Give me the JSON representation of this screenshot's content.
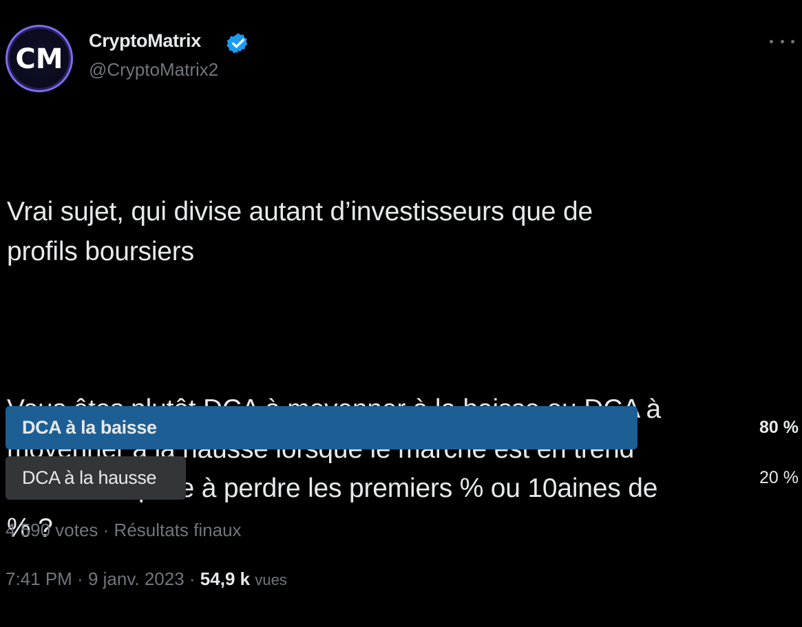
{
  "author": {
    "name": "CryptoMatrix",
    "handle": "@CryptoMatrix2",
    "avatar_text": "CM",
    "verified_color": "#1d9bf0"
  },
  "tweet": {
    "paragraph1": "Vrai sujet, qui divise autant d’investisseurs que de\nprofils boursiers",
    "paragraph2": "Vous êtes plutôt DCA à moyenner à la baisse ou DCA à\nmoyenner à la hausse lorsque le marché est en trend\nhaussière quitte à perdre les premiers % ou 10aines de\n% ?"
  },
  "poll": {
    "options": [
      {
        "label": "DCA à la baisse",
        "percent_text": "80 %",
        "fraction": 0.8,
        "winner": true,
        "bar_color": "#1d5f94"
      },
      {
        "label": "DCA à la hausse",
        "percent_text": "20 %",
        "fraction": 0.2,
        "winner": false,
        "bar_color": "#333639"
      }
    ],
    "votes": "4 590 votes",
    "separator": " · ",
    "status": "Résultats finaux"
  },
  "footer": {
    "time": "7:41 PM",
    "separator": " · ",
    "date": "9 janv. 2023",
    "views_count": "54,9 k",
    "views_label": "vues"
  },
  "icons": {
    "more": "more-options-icon",
    "verified": "verified-badge-icon"
  }
}
